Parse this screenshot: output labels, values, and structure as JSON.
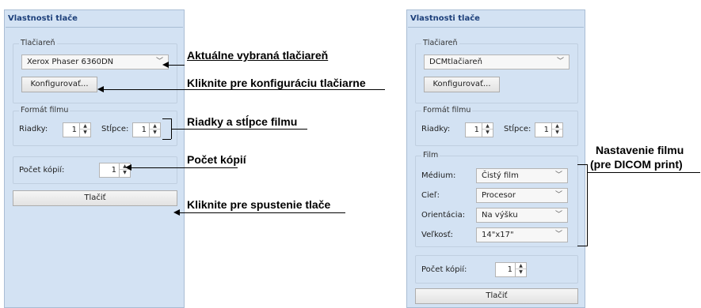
{
  "left_panel": {
    "title": "Vlastnosti tlače",
    "printer_group": {
      "label": "Tlačiareň",
      "selected_printer": "Xerox Phaser 6360DN",
      "configure_button": "Konfigurovať..."
    },
    "film_format_group": {
      "label": "Formát filmu",
      "rows_label": "Riadky:",
      "rows_value": "1",
      "cols_label": "Stĺpce:",
      "cols_value": "1"
    },
    "copies_group": {
      "label": "Počet kópií:",
      "value": "1"
    },
    "print_button": "Tlačiť"
  },
  "right_panel": {
    "title": "Vlastnosti tlače",
    "printer_group": {
      "label": "Tlačiareň",
      "selected_printer": "DCMtlačiareň",
      "configure_button": "Konfigurovať..."
    },
    "film_format_group": {
      "label": "Formát filmu",
      "rows_label": "Riadky:",
      "rows_value": "1",
      "cols_label": "Stĺpce:",
      "cols_value": "1"
    },
    "film_group": {
      "label": "Film",
      "medium_label": "Médium:",
      "medium_value": "Čistý film",
      "target_label": "Cieľ:",
      "target_value": "Procesor",
      "orientation_label": "Orientácia:",
      "orientation_value": "Na výšku",
      "size_label": "Veľkosť:",
      "size_value": "14\"x17\""
    },
    "copies_group": {
      "label": "Počet kópií:",
      "value": "1"
    },
    "print_button": "Tlačiť"
  },
  "annotations": {
    "selected_printer": "Aktuálne vybraná tlačiareň",
    "configure": "Kliknite pre konfiguráciu tlačiarne",
    "rows_cols": "Riadky a stĺpce filmu",
    "copies": "Počet kópií",
    "print": "Kliknite pre spustenie tlače",
    "film_line1": "Nastavenie filmu",
    "film_line2": "(pre DICOM print)"
  }
}
